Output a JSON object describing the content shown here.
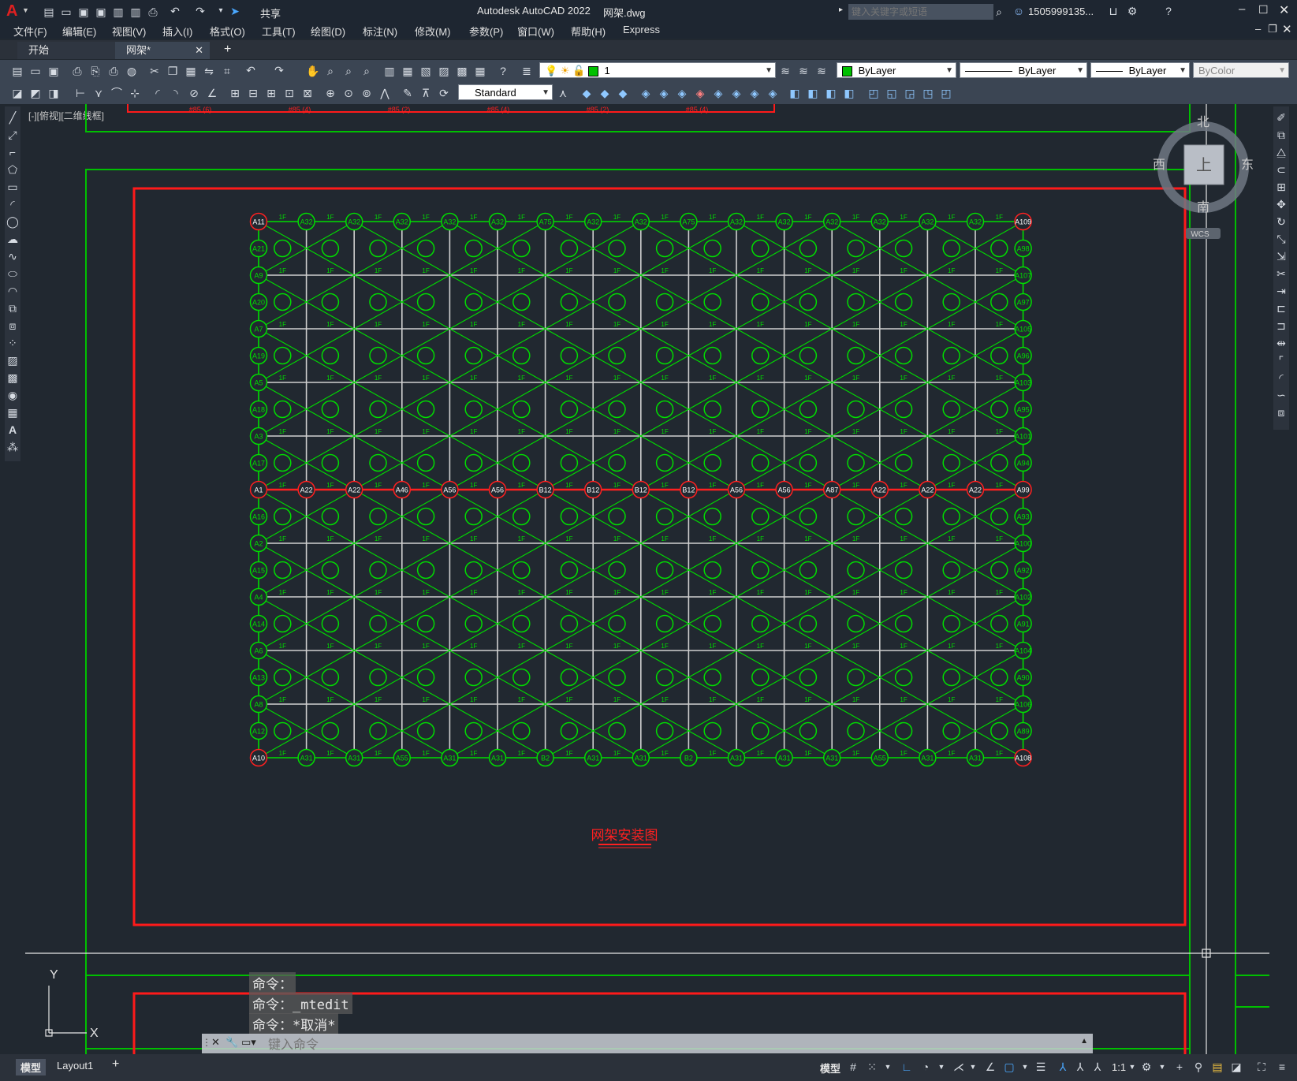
{
  "app": {
    "title": "Autodesk AutoCAD 2022",
    "filename": "网架.dwg",
    "search_placeholder": "键入关键字或短语",
    "user": "1505999135...",
    "share_label": "共享",
    "logo": "A"
  },
  "menu": [
    "文件(F)",
    "编辑(E)",
    "视图(V)",
    "插入(I)",
    "格式(O)",
    "工具(T)",
    "绘图(D)",
    "标注(N)",
    "修改(M)",
    "参数(P)",
    "窗口(W)",
    "帮助(H)",
    "Express"
  ],
  "tabs": [
    {
      "label": "开始"
    },
    {
      "label": "网架*"
    }
  ],
  "toolbar": {
    "layer_name": "1",
    "color_value": "ByLayer",
    "linetype_value": "ByLayer",
    "lineweight_value": "ByLayer",
    "plotstyle_value": "ByColor",
    "textstyle_value": "Standard",
    "layer_color": "#00c000"
  },
  "viewport": {
    "label": "[-][俯视][二维线框]",
    "drawing_title": "网架安装图",
    "viewcube": {
      "north": "北",
      "south": "南",
      "east": "东",
      "west": "西",
      "face": "上",
      "wcs": "WCS"
    },
    "ucs": {
      "x": "X",
      "y": "Y"
    },
    "grid": {
      "cols": 16,
      "rows": 20
    },
    "nodes_left": [
      "A11",
      "A21",
      "A9",
      "A20",
      "A7",
      "A19",
      "A5",
      "A18",
      "A3",
      "A17",
      "A1",
      "A16",
      "A2",
      "A15",
      "A4",
      "A14",
      "A6",
      "A13",
      "A8",
      "A12",
      "A10"
    ],
    "nodes_right": [
      "A109",
      "A98",
      "A107",
      "A97",
      "A105",
      "A96",
      "A103",
      "A95",
      "A101",
      "A94",
      "A99",
      "A93",
      "A100",
      "A92",
      "A102",
      "A91",
      "A104",
      "A90",
      "A106",
      "A89",
      "A108"
    ],
    "nodes_top": [
      "A32",
      "A32",
      "A32",
      "A32",
      "A32",
      "A75",
      "A32",
      "A32",
      "A75",
      "A32",
      "A32",
      "A32",
      "A32",
      "A32",
      "A32"
    ],
    "nodes_bottom": [
      "A31",
      "A31",
      "A55",
      "A31",
      "A31",
      "B2",
      "A31",
      "A31",
      "B2",
      "A31",
      "A31",
      "A31",
      "A55",
      "A31",
      "A31"
    ],
    "nodes_middle": [
      "A22",
      "A22",
      "A46",
      "A56",
      "A56",
      "B12",
      "B12",
      "B12",
      "B12",
      "A56",
      "A56",
      "A87",
      "A22",
      "A22",
      "A22"
    ],
    "top_labels": [
      "#85 (6)",
      "#85 (4)",
      "#85 (2)",
      "#85 (4)",
      "#85 (2)",
      "#85 (4)"
    ],
    "colors": {
      "node": "#00dd00",
      "node_red": "#ff2020",
      "frame_green": "#00c000",
      "frame_red": "#ff1a1a",
      "grid_white": "#d0d0d0"
    }
  },
  "command": {
    "history": [
      "命令：",
      "命令：_mtedit",
      "命令：*取消*"
    ],
    "placeholder": "键入命令"
  },
  "status": {
    "layout_tabs": [
      "模型",
      "Layout1"
    ],
    "model_label": "模型",
    "scale": "1:1"
  }
}
